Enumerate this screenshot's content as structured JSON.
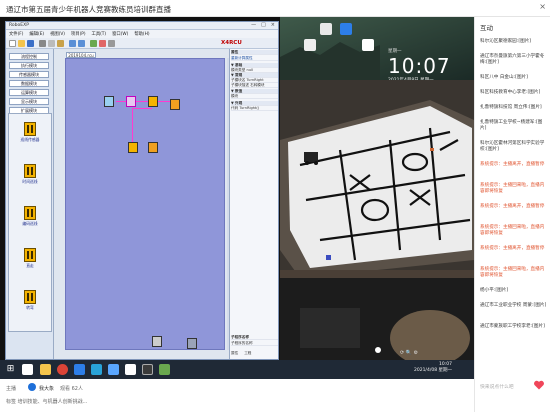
{
  "header": {
    "title": "通辽市第五届青少年机器人竞赛教练员培训群直播",
    "buttons": [
      "×"
    ]
  },
  "app": {
    "title": "RoboEXP",
    "window_controls": [
      "—",
      "□",
      "×"
    ],
    "menu": [
      "文件(F)",
      "编辑(E)",
      "视图(V)",
      "项目(P)",
      "工具(T)",
      "窗口(W)",
      "帮助(H)"
    ],
    "brand": "X4RCU",
    "left_buttons": [
      "流程控制",
      "执行模块",
      "传感器模块",
      "数据模块",
      "运算模块",
      "显示模块",
      "扩展模块",
      "其他模块"
    ],
    "palette_title": "111",
    "palette": [
      "巡线传感器",
      "时间巡线",
      "编码巡线",
      "直走",
      "转弯"
    ],
    "canvas_tab": "2019104.rcu",
    "properties": {
      "header": "属性",
      "tab": "重新计算属性",
      "rows": [
        {
          "section": true,
          "text": "▼ 基础"
        },
        {
          "text": "模块类型  null"
        },
        {
          "section": true,
          "text": "▼ 常规"
        },
        {
          "text": "子模块名  TurnRight"
        },
        {
          "text": "子模块描述  右转模块"
        },
        {
          "section": true,
          "text": "▼ 数值"
        },
        {
          "text": "模块"
        },
        {
          "section": true,
          "text": "▼ 外观"
        },
        {
          "text": "代码  TurnRight()"
        }
      ],
      "footer1": "子程序名称",
      "footer2": "子程序的名称",
      "footer_tabs": [
        "属性",
        "工程"
      ]
    }
  },
  "desktop": {
    "day": "星期一",
    "time": "10:07",
    "date": "2021年4月8日 星期一"
  },
  "taskbar": {
    "time": "10:07",
    "date": "2021/4/08 星期一"
  },
  "footer": {
    "host_label": "主播",
    "host_name": "我大象",
    "view_label": "观看",
    "view_count": "62人",
    "tag_line": "标签  培训技能、与机器人创新挑战..."
  },
  "chat": {
    "header": "互动",
    "messages": [
      {
        "text": "科尔沁区聚德家园:",
        "badge": "[图片]",
        "sys": false
      },
      {
        "text": "通辽市奈曼旗第六第三小学霍冬梅:",
        "badge": "[图片]",
        "sys": false
      },
      {
        "text": "科区八中 白金山:",
        "badge": "[图片]",
        "sys": false
      },
      {
        "text": "科区科技教育中心李老:",
        "badge": "[图片]",
        "sys": false
      },
      {
        "text": "扎鲁特旗科技馆 周立伟:",
        "badge": "[图片]",
        "sys": false
      },
      {
        "text": "扎鲁特旗工业学校~杨建军:",
        "badge": "[图片]",
        "sys": false
      },
      {
        "text": "科尔沁区霍林河第区科学实验学校:",
        "badge": "[图片]",
        "sys": false
      },
      {
        "text": "系统提示：主播离开，直播暂停",
        "badge": "",
        "sys": true
      },
      {
        "text": "系统提示：主播回来啦，直播内容即将恢复",
        "badge": "",
        "sys": true
      },
      {
        "text": "系统提示：主播离开，直播暂停",
        "badge": "",
        "sys": true
      },
      {
        "text": "系统提示：主播回来啦，直播内容即将恢复",
        "badge": "",
        "sys": true
      },
      {
        "text": "系统提示：主播离开，直播暂停",
        "badge": "",
        "sys": true
      },
      {
        "text": "系统提示：主播回来啦，直播内容即将恢复",
        "badge": "",
        "sys": true
      },
      {
        "text": "杨小平:",
        "badge": "[图片]",
        "sys": false
      },
      {
        "text": "通辽市工业职业学校 周蒙:",
        "badge": "[图片]",
        "sys": false
      },
      {
        "text": "通辽市蒙族职工学校李老:",
        "badge": "[图片]",
        "sys": false
      }
    ],
    "input_placeholder": "快来说点什么吧"
  },
  "colors": {
    "canvas": "#8f96d9",
    "wire": "#ff3bd0",
    "system_message": "#e0542f",
    "brand": "#c00000"
  }
}
